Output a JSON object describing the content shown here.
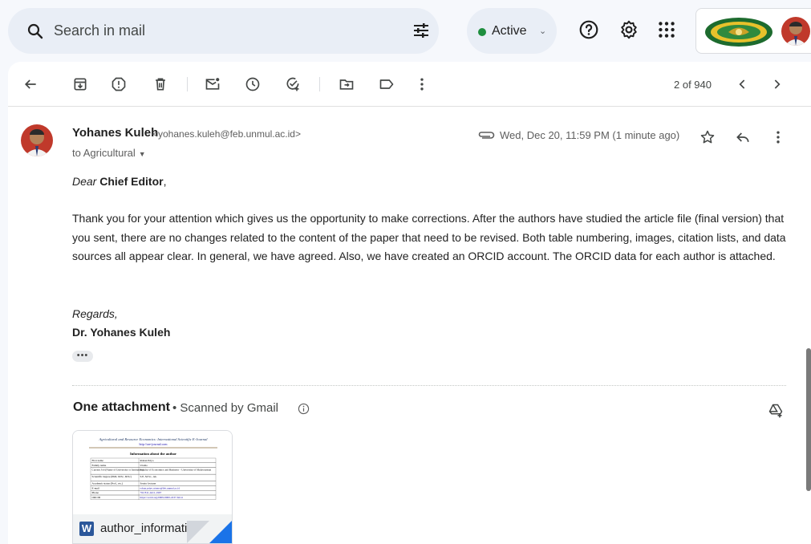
{
  "search": {
    "placeholder": "Search in mail"
  },
  "status": {
    "label": "Active",
    "color": "#1e8e3e"
  },
  "icons": {
    "search": "search-icon",
    "filter": "tune-icon",
    "help": "help-icon",
    "settings": "gear-icon",
    "apps": "apps-grid-icon",
    "back": "arrow-back-icon",
    "archive": "archive-icon",
    "spam": "report-spam-icon",
    "delete": "trash-icon",
    "unread": "mark-unread-icon",
    "snooze": "snooze-icon",
    "task": "add-task-icon",
    "move": "move-to-icon",
    "label": "label-icon",
    "more": "more-vert-icon",
    "prev": "chevron-left-icon",
    "next": "chevron-right-icon",
    "star": "star-icon",
    "reply": "reply-icon",
    "attachment": "paperclip-icon",
    "info": "info-icon",
    "drive": "add-to-drive-icon"
  },
  "toolbar": {
    "page_count": "2 of 940"
  },
  "message": {
    "sender_name": "Yohanes Kuleh",
    "sender_email": "<yohanes.kuleh@feb.unmul.ac.id>",
    "recipient": "to Agricultural",
    "date": "Wed, Dec 20, 11:59 PM (1 minute ago)",
    "greeting_prefix": "Dear ",
    "greeting_name": "Chief Editor",
    "greeting_suffix": ",",
    "body": "Thank you for your attention which gives us the opportunity to make corrections. After the authors have studied the article file (final version) that you sent, there are no changes related to the content of the paper that need to be revised. Both table numbering, images, citation lists, and data sources all appear clear. In general, we have agreed. Also, we have created an ORCID account. The ORCID data for each author is attached.",
    "regards": "Regards,",
    "signature": "Dr. Yohanes Kuleh",
    "more": "•••"
  },
  "attachments": {
    "title": "One attachment",
    "scanned": "•  Scanned by Gmail",
    "items": [
      {
        "name": "author_informati...",
        "type_badge": "W",
        "preview": {
          "journal": "Agricultural and Resource Economics: International Scientific E-Journal",
          "url": "http://are-journal.com",
          "heading": "Information about the author",
          "rows": [
            [
              "First name",
              "Rohan Priyo"
            ],
            [
              "Family name",
              "Utomo"
            ],
            [
              "Current Job (Name of University or Institution)",
              "Faculty of Economics and Business – University of Mulawarman"
            ],
            [
              "Scientific degree (PhD, DrSc, DrSc)",
              "S.E, M.Sc., Ak."
            ],
            [
              "Academic status (Prof., etc.)",
              "Senior lecturer"
            ],
            [
              "E-mail",
              "rohan.priyo.utomo@feb.unmul.ac.id"
            ],
            [
              "Phone",
              "+62 811-4411-1997"
            ],
            [
              "ORCID",
              "https://orcid.org/0009-0000-2237-6414"
            ]
          ]
        }
      }
    ]
  }
}
